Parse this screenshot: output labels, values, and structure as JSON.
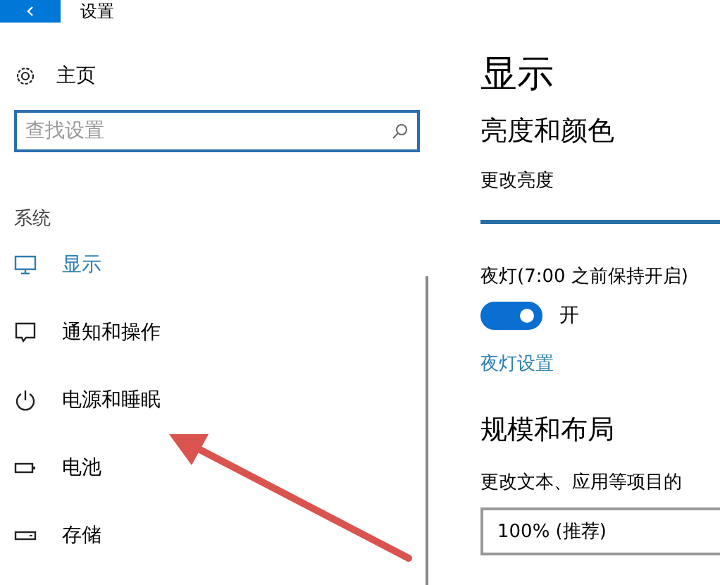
{
  "window": {
    "title": "设置"
  },
  "sidebar": {
    "home": "主页",
    "search": {
      "placeholder": "查找设置"
    },
    "section": "系统",
    "items": [
      {
        "label": "显示",
        "kind": "monitor",
        "selected": true
      },
      {
        "label": "通知和操作",
        "kind": "message",
        "selected": false
      },
      {
        "label": "电源和睡眠",
        "kind": "power",
        "selected": false
      },
      {
        "label": "电池",
        "kind": "battery",
        "selected": false
      },
      {
        "label": "存储",
        "kind": "drive",
        "selected": false
      }
    ]
  },
  "content": {
    "title": "显示",
    "brightness_heading": "亮度和颜色",
    "brightness_label": "更改亮度",
    "brightness": {
      "level": 1
    },
    "night_light": {
      "label": "夜灯(7:00 之前保持开启)",
      "on": true,
      "state_text": "开"
    },
    "night_light_link": "夜灯设置",
    "scale_heading": "规模和布局",
    "scale_label": "更改文本、应用等项目的",
    "scale_value": "100% (推荐)"
  },
  "annotation": {
    "kind": "arrow"
  }
}
